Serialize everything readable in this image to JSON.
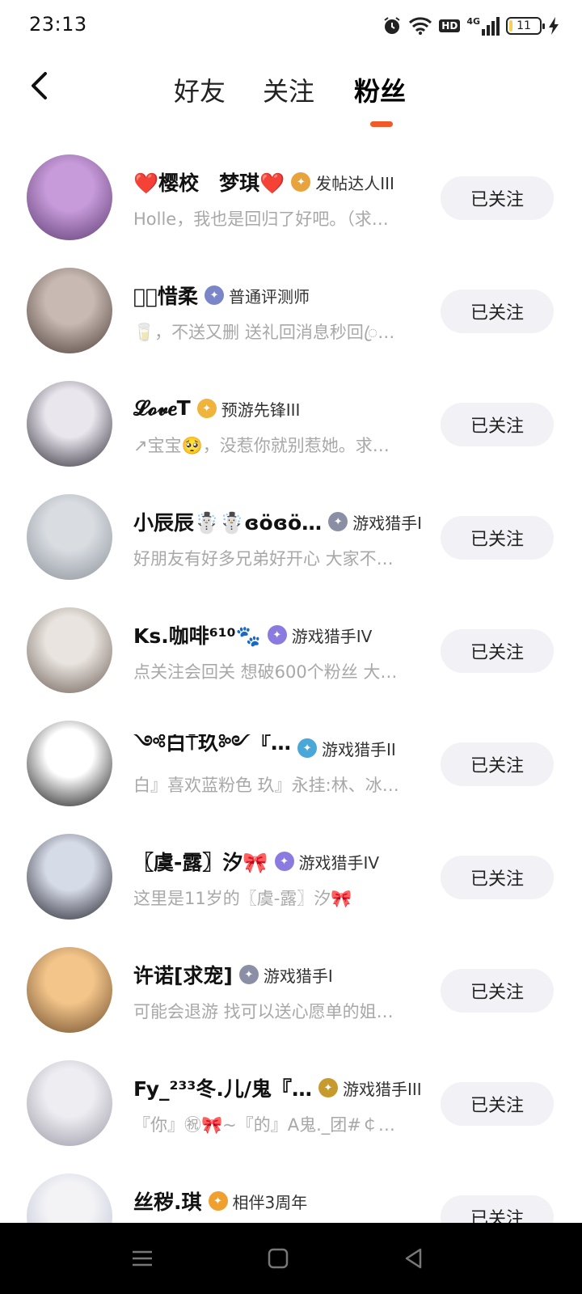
{
  "status_bar": {
    "time": "23:13",
    "hd_label": "HD",
    "network_label": "4G",
    "battery_level": "11"
  },
  "nav": {
    "back_icon": "chevron-left-icon",
    "tabs": [
      {
        "label": "好友",
        "active": false
      },
      {
        "label": "关注",
        "active": false
      },
      {
        "label": "粉丝",
        "active": true
      }
    ],
    "accent_color": "#f05a28"
  },
  "followers": [
    {
      "name": "❤️樱校　梦琪❤️",
      "badge_label": "发帖达人III",
      "badge_color": "#e8a33c",
      "bio": "Holle，我也是回归了好吧。（求…",
      "button_label": "已关注",
      "avatar_colors": [
        "#c79ad9",
        "#5a3b70"
      ]
    },
    {
      "name": "𝓜ꦿ惜柔",
      "badge_label": "普通评测师",
      "badge_color": "#7b86c9",
      "bio": "🥛，不送又删 送礼回消息秒回ꦿ…",
      "button_label": "已关注",
      "avatar_colors": [
        "#c8b9b2",
        "#4a3b36"
      ]
    },
    {
      "name": "𝓛𝓸𝓿𝒆T",
      "badge_label": "预游先锋III",
      "badge_color": "#f0b43c",
      "bio": "↗宝宝🥺，没惹你就别惹她。求…",
      "button_label": "已关注",
      "avatar_colors": [
        "#eae6ee",
        "#2e2a35"
      ]
    },
    {
      "name": "小辰辰☃️☃️ɞöɞö…",
      "badge_label": "游戏猎手I",
      "badge_color": "#8a8fa6",
      "bio": "好朋友有好多兄弟好开心 大家不…",
      "button_label": "已关注",
      "avatar_colors": [
        "#d9dde2",
        "#8a9098"
      ]
    },
    {
      "name": "Ks.咖啡⁶¹⁰🐾",
      "badge_label": "游戏猎手IV",
      "badge_color": "#8b7be0",
      "bio": "点关注会回关 想破600个粉丝 大…",
      "button_label": "已关注",
      "avatar_colors": [
        "#e9e4df",
        "#6b5d55"
      ]
    },
    {
      "name": "༺白⍑玖༻『…",
      "badge_label": "游戏猎手II",
      "badge_color": "#4aa8d8",
      "bio": "白』喜欢蓝粉色 玖』永挂:林、冰…",
      "button_label": "已关注",
      "avatar_colors": [
        "#ffffff",
        "#111111"
      ]
    },
    {
      "name": "〖虞-露〗汐🎀",
      "badge_label": "游戏猎手IV",
      "badge_color": "#8b7be0",
      "bio": "这里是11岁的〖虞-露〗汐🎀",
      "button_label": "已关注",
      "avatar_colors": [
        "#d6dbe8",
        "#1f1f28"
      ]
    },
    {
      "name": "许诺[求宠]",
      "badge_label": "游戏猎手I",
      "badge_color": "#8a8fa6",
      "bio": "可能会退游 找可以送心愿单的姐…",
      "button_label": "已关注",
      "avatar_colors": [
        "#f3c58a",
        "#6b4a2a"
      ]
    },
    {
      "name": "Fy_²³³冬.儿/鬼『…",
      "badge_label": "游戏猎手III",
      "badge_color": "#c79a2e",
      "bio": "『你』㊗🎀~『的』A鬼._团#￠…",
      "button_label": "已关注",
      "avatar_colors": [
        "#eeeef2",
        "#9a98a6"
      ]
    },
    {
      "name": "丝秽.琪",
      "badge_label": "相伴3周年",
      "badge_color": "#f0a02e",
      "bio": "",
      "button_label": "已关注",
      "avatar_colors": [
        "#f3f3f6",
        "#b8bfd1"
      ]
    }
  ],
  "system_nav": {
    "items": [
      "menu-icon",
      "home-icon",
      "back-icon"
    ]
  }
}
